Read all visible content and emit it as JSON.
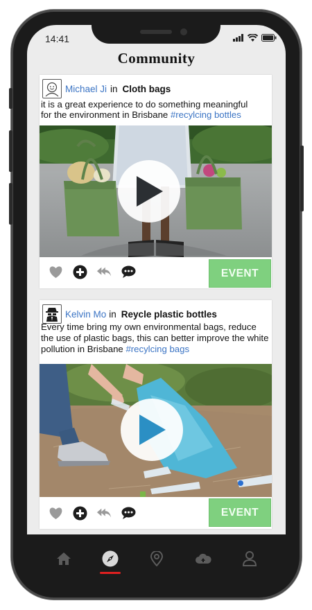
{
  "status_bar": {
    "time": "14:41"
  },
  "page": {
    "title": "Community"
  },
  "posts": [
    {
      "user": "Michael Ji",
      "in_word": "in",
      "topic": "Cloth bags",
      "text_line1": "it is a great experience to do something meaningful",
      "text_line2_prefix": "for the environment in Brisbane ",
      "hashtag": "#recylcing bottles",
      "event_label": "EVENT",
      "media_icon": "play-icon"
    },
    {
      "user": "Kelvin Mo",
      "in_word": "in",
      "topic": "Reycle plastic bottles",
      "text_line1": "Every time bring my own environmental bags, reduce",
      "text_line2": "the use of plastic bags, this can better improve the white",
      "text_line3_prefix": "pollution in Brisbane ",
      "hashtag": "#recylcing bags",
      "event_label": "EVENT",
      "media_icon": "play-icon"
    }
  ],
  "actions": [
    "heart-icon",
    "add-circle-icon",
    "reply-all-icon",
    "comment-icon"
  ],
  "bottom_nav": {
    "items": [
      "home-icon",
      "compass-icon",
      "location-pin-icon",
      "cloud-icon",
      "profile-icon"
    ],
    "active": "compass-icon"
  },
  "colors": {
    "link": "#3b74c4",
    "event_button": "#7fd07f",
    "active_indicator": "#e02020",
    "screen_background": "#ececec"
  }
}
